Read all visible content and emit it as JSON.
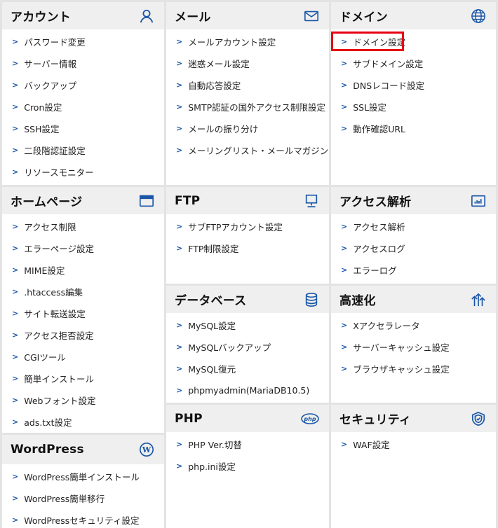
{
  "panels": {
    "account": {
      "title": "アカウント",
      "icon": "user-icon",
      "items": [
        "パスワード変更",
        "サーバー情報",
        "バックアップ",
        "Cron設定",
        "SSH設定",
        "二段階認証設定",
        "リソースモニター"
      ]
    },
    "mail": {
      "title": "メール",
      "icon": "envelope-icon",
      "items": [
        "メールアカウント設定",
        "迷惑メール設定",
        "自動応答設定",
        "SMTP認証の国外アクセス制限設定",
        "メールの振り分け",
        "メーリングリスト・メールマガジン"
      ]
    },
    "domain": {
      "title": "ドメイン",
      "icon": "globe-icon",
      "items": [
        "ドメイン設定",
        "サブドメイン設定",
        "DNSレコード設定",
        "SSL設定",
        "動作確認URL"
      ]
    },
    "homepage": {
      "title": "ホームページ",
      "icon": "browser-window-icon",
      "items": [
        "アクセス制限",
        "エラーページ設定",
        "MIME設定",
        ".htaccess編集",
        "サイト転送設定",
        "アクセス拒否設定",
        "CGIツール",
        "簡単インストール",
        "Webフォント設定",
        "ads.txt設定"
      ]
    },
    "ftp": {
      "title": "FTP",
      "icon": "monitor-icon",
      "items": [
        "サブFTPアカウント設定",
        "FTP制限設定"
      ]
    },
    "analytics": {
      "title": "アクセス解析",
      "icon": "bar-chart-icon",
      "items": [
        "アクセス解析",
        "アクセスログ",
        "エラーログ"
      ]
    },
    "database": {
      "title": "データベース",
      "icon": "database-icon",
      "items": [
        "MySQL設定",
        "MySQLバックアップ",
        "MySQL復元",
        "phpmyadmin(MariaDB10.5)"
      ]
    },
    "speed": {
      "title": "高速化",
      "icon": "speed-arrows-icon",
      "items": [
        "Xアクセラレータ",
        "サーバーキャッシュ設定",
        "ブラウザキャッシュ設定"
      ]
    },
    "php": {
      "title": "PHP",
      "icon": "php-icon",
      "items": [
        "PHP Ver.切替",
        "php.ini設定"
      ]
    },
    "security": {
      "title": "セキュリティ",
      "icon": "shield-icon",
      "items": [
        "WAF設定"
      ]
    },
    "wordpress": {
      "title": "WordPress",
      "icon": "wordpress-icon",
      "items": [
        "WordPress簡単インストール",
        "WordPress簡単移行",
        "WordPressセキュリティ設定"
      ]
    }
  },
  "php_icon_text": "php",
  "colors": {
    "accent": "#1a56a8",
    "highlight": "#e60012",
    "header_bg": "#efefef",
    "divider": "#e3e3e3"
  }
}
